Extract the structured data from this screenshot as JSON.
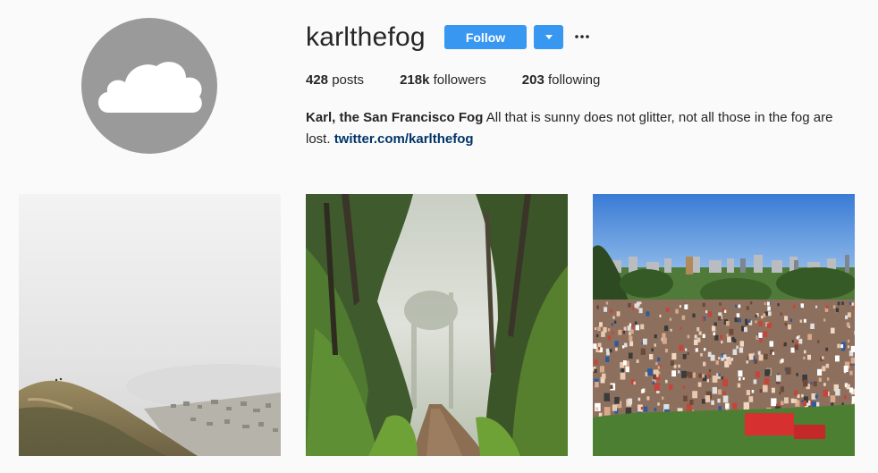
{
  "profile": {
    "username": "karlthefog",
    "avatar_icon": "cloud-icon",
    "follow_label": "Follow",
    "dropdown_icon": "caret-down-icon",
    "more_icon": "ellipsis-icon"
  },
  "stats": {
    "posts_count": "428",
    "posts_label": " posts",
    "followers_count": "218k",
    "followers_label": " followers",
    "following_count": "203",
    "following_label": " following"
  },
  "bio": {
    "name": "Karl, the San Francisco Fog",
    "text": " All that is sunny does not glitter, not all those in the fog are lost. ",
    "link": "twitter.com/karlthefog"
  },
  "colors": {
    "accent": "#3897f0",
    "link": "#003569",
    "avatar_bg": "#9a9a9a",
    "page_bg": "#fafafa"
  }
}
